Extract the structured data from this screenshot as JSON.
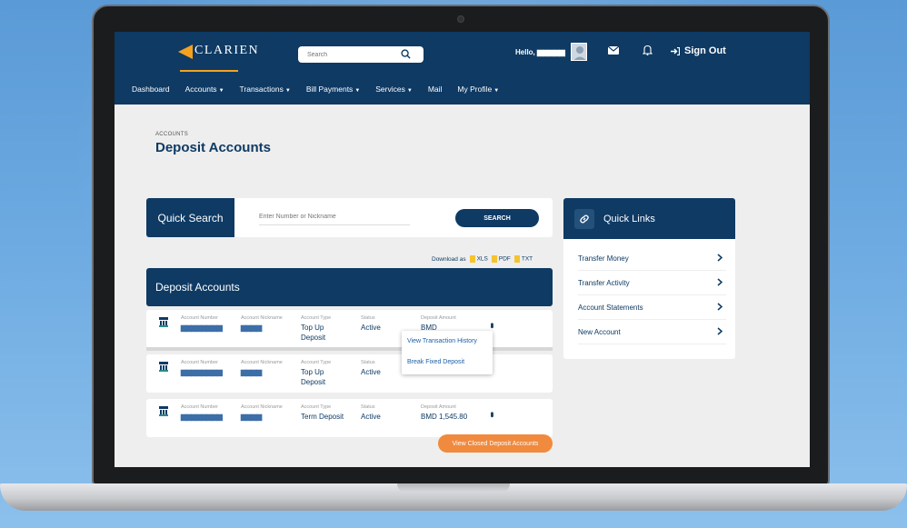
{
  "header": {
    "brand": "CLARIEN",
    "search_placeholder": "Search",
    "greeting": "Hello, ▆▆▆▆▆",
    "sign_out": "Sign Out"
  },
  "nav": [
    {
      "label": "Dashboard",
      "dropdown": false
    },
    {
      "label": "Accounts",
      "dropdown": true
    },
    {
      "label": "Transactions",
      "dropdown": true
    },
    {
      "label": "Bill Payments",
      "dropdown": true
    },
    {
      "label": "Services",
      "dropdown": true
    },
    {
      "label": "Mail",
      "dropdown": false
    },
    {
      "label": "My Profile",
      "dropdown": true
    }
  ],
  "page": {
    "breadcrumb": "ACCOUNTS",
    "title": "Deposit Accounts"
  },
  "quick_search": {
    "label": "Quick Search",
    "placeholder": "Enter Number or Nickname",
    "button": "SEARCH"
  },
  "download": {
    "label": "Download as",
    "formats": [
      "XLS",
      "PDF",
      "TXT"
    ]
  },
  "deposit_section": {
    "title": "Deposit Accounts",
    "column_labels": {
      "number": "Account Number",
      "nickname": "Account Nickname",
      "type": "Account Type",
      "status": "Status",
      "amount": "Deposit Amount"
    },
    "rows": [
      {
        "number": "▆▆▆▆▆▆▆▆",
        "nickname": "▆▆▆▆",
        "type_line1": "Top Up",
        "type_line2": "Deposit",
        "status": "Active",
        "amount": "BMD"
      },
      {
        "number": "▆▆▆▆▆▆▆▆",
        "nickname": "▆▆▆▆",
        "type_line1": "Top Up",
        "type_line2": "Deposit",
        "status": "Active",
        "amount": ""
      },
      {
        "number": "▆▆▆▆▆▆▆▆",
        "nickname": "▆▆▆▆",
        "type_line1": "Term Deposit",
        "type_line2": "",
        "status": "Active",
        "amount": "BMD 1,545.80"
      }
    ],
    "context_menu": [
      "View Transaction History",
      "Break Fixed Deposit"
    ],
    "view_closed": "View Closed Deposit Accounts"
  },
  "quick_links": {
    "title": "Quick Links",
    "items": [
      "Transfer Money",
      "Transfer Activity",
      "Account Statements",
      "New Account"
    ]
  },
  "colors": {
    "primary": "#0e3a64",
    "accent": "#f4a21e",
    "orange_button": "#f08a3e"
  }
}
